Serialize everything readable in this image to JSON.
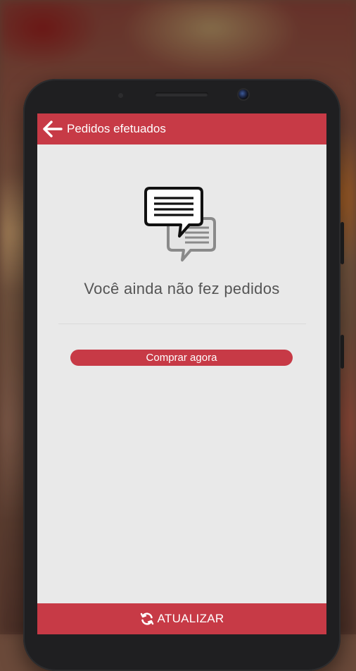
{
  "appbar": {
    "title": "Pedidos efetuados",
    "back_icon": "arrow-left-icon"
  },
  "empty_state": {
    "icon": "chat-bubbles-icon",
    "message": "Você ainda não fez pedidos",
    "button_label": "Comprar agora"
  },
  "bottombar": {
    "icon": "refresh-icon",
    "label": "ATUALIZAR"
  },
  "colors": {
    "accent": "#c73a46",
    "screen_bg": "#e9e9e9",
    "text": "#555555"
  }
}
